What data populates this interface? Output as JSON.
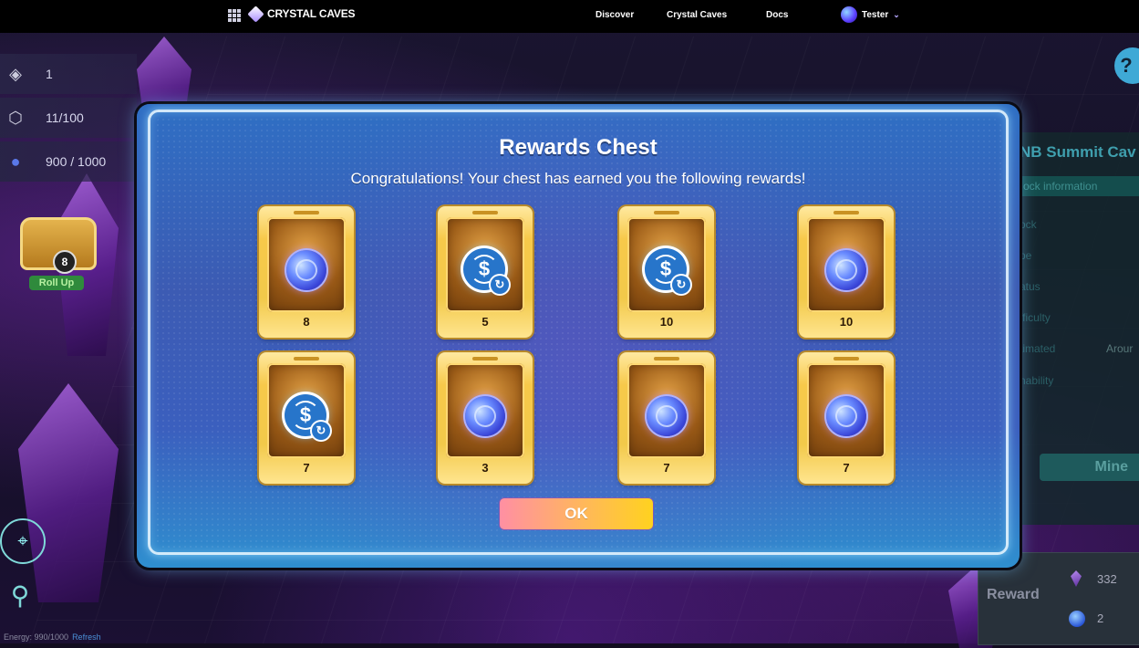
{
  "nav": {
    "brand": "CRYSTAL CAVES",
    "links": [
      "Discover",
      "Crystal Caves",
      "Docs"
    ],
    "user": "Tester"
  },
  "hud": {
    "level": "1",
    "capacity": "11/100",
    "energy": "900 / 1000",
    "chest_count": "8",
    "rollup_label": "Roll Up",
    "energy_footer": "Energy: 990/1000",
    "refresh_label": "Refresh"
  },
  "side_panel": {
    "title": "NB Summit Cav",
    "tab": "ock information",
    "rows": [
      "ock",
      "pe",
      "atus",
      "fficulty",
      "timated",
      "nability"
    ],
    "around": "Arour",
    "mine_label": "Mine",
    "reward_label": "Reward",
    "reward_values": [
      "332",
      "2"
    ]
  },
  "modal": {
    "title": "Rewards Chest",
    "subtitle": "Congratulations! Your chest has earned you the following rewards!",
    "ok_label": "OK",
    "rewards": [
      {
        "type": "coin",
        "amount": "8"
      },
      {
        "type": "usdc",
        "amount": "5"
      },
      {
        "type": "usdc",
        "amount": "10"
      },
      {
        "type": "coin",
        "amount": "10"
      },
      {
        "type": "usdc",
        "amount": "7"
      },
      {
        "type": "coin",
        "amount": "3"
      },
      {
        "type": "coin",
        "amount": "7"
      },
      {
        "type": "coin",
        "amount": "7"
      }
    ]
  }
}
